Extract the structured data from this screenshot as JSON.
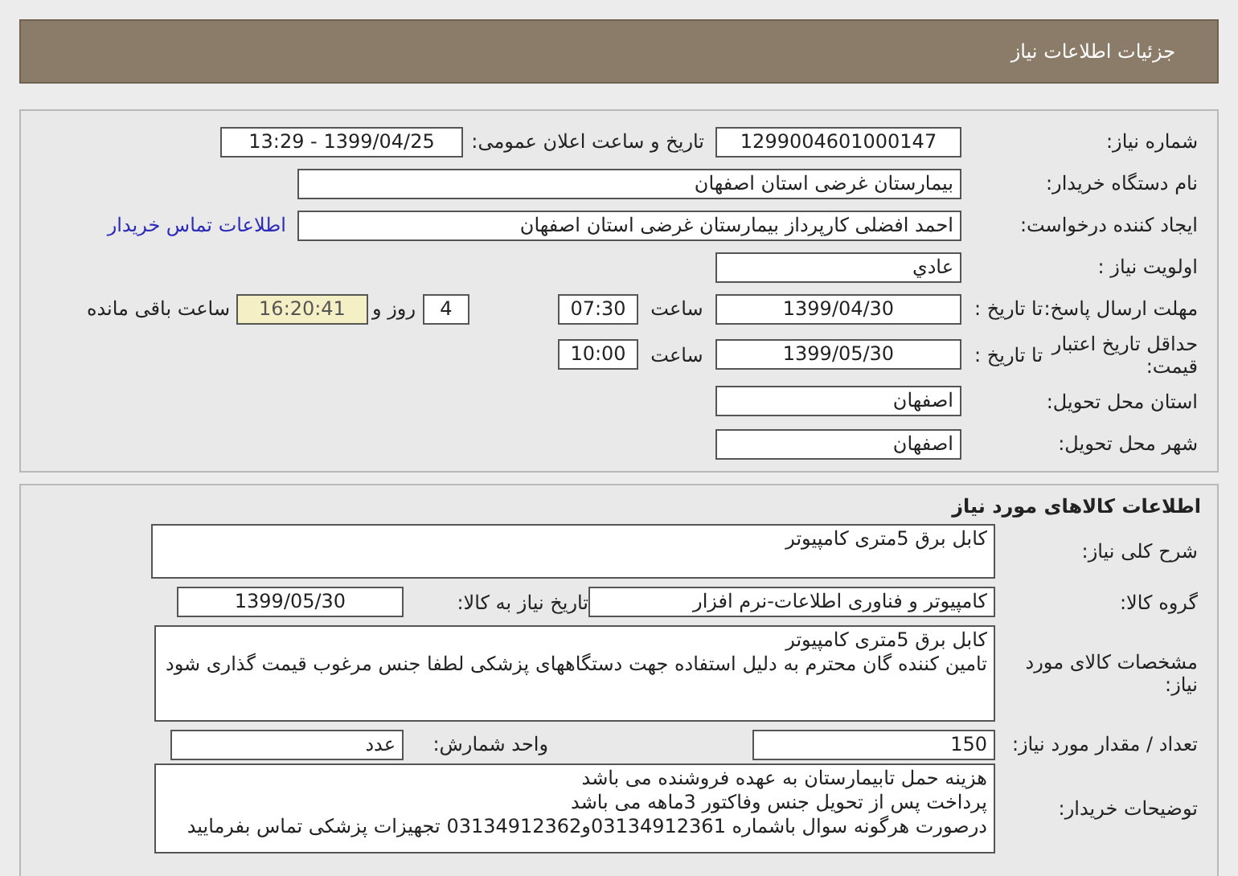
{
  "header": {
    "title": "جزئیات اطلاعات نیاز"
  },
  "details": {
    "rows": [
      {
        "label": "شماره نیاز:",
        "parts": [
          {
            "kind": "field",
            "value": "1299004601000147"
          },
          {
            "kind": "text",
            "text": "تاریخ و ساعت اعلان عمومی:"
          },
          {
            "kind": "field",
            "value": "1399/04/25 - 13:29"
          }
        ]
      },
      {
        "label": "نام دستگاه خریدار:",
        "parts": [
          {
            "kind": "field",
            "value": "بیمارستان غرضی استان اصفهان"
          }
        ]
      },
      {
        "label": "ایجاد کننده درخواست:",
        "parts": [
          {
            "kind": "field",
            "value": "احمد افضلی کارپرداز بیمارستان غرضی استان اصفهان"
          },
          {
            "kind": "link",
            "text": "اطلاعات تماس خریدار"
          }
        ]
      },
      {
        "label": "اولویت نیاز :",
        "parts": [
          {
            "kind": "field",
            "value": "عادي"
          }
        ]
      },
      {
        "label": "مهلت ارسال پاسخ:",
        "sublabel": "تا تاریخ :",
        "parts": [
          {
            "kind": "field",
            "value": "1399/04/30"
          },
          {
            "kind": "text",
            "text": "ساعت"
          },
          {
            "kind": "field",
            "value": "07:30"
          },
          {
            "kind": "field",
            "value": "4"
          },
          {
            "kind": "text",
            "text": "روز و"
          },
          {
            "kind": "timer",
            "value": "16:20:41"
          },
          {
            "kind": "text",
            "text": "ساعت باقی مانده"
          }
        ]
      },
      {
        "label": "حداقل تاریخ اعتبار قیمت:",
        "sublabel": "تا تاریخ :",
        "parts": [
          {
            "kind": "field",
            "value": "1399/05/30"
          },
          {
            "kind": "text",
            "text": "ساعت"
          },
          {
            "kind": "field",
            "value": "10:00"
          }
        ]
      },
      {
        "label": "استان محل تحویل:",
        "parts": [
          {
            "kind": "field",
            "value": "اصفهان"
          }
        ]
      },
      {
        "label": "شهر محل تحویل:",
        "parts": [
          {
            "kind": "field",
            "value": "اصفهان"
          }
        ]
      }
    ]
  },
  "goods": {
    "title": "اطلاعات کالاهای مورد نیاز",
    "rows": [
      {
        "label": "شرح کلی نیاز:",
        "parts": [
          {
            "kind": "textarea",
            "lines": [
              "کابل برق 5متری کامپیوتر"
            ]
          }
        ]
      },
      {
        "label": "گروه کالا:",
        "parts": [
          {
            "kind": "field",
            "value": "کامپیوتر و فناوری اطلاعات-نرم افزار"
          },
          {
            "kind": "text",
            "text": "تاریخ نیاز به کالا:"
          },
          {
            "kind": "field",
            "value": "1399/05/30"
          }
        ]
      },
      {
        "label": "مشخصات کالای مورد نیاز:",
        "parts": [
          {
            "kind": "textarea",
            "lines": [
              "کابل برق 5متری کامپیوتر",
              "تامین کننده گان محترم به دلیل استفاده جهت دستگاههای پزشکی لطفا جنس مرغوب قیمت گذاری شود"
            ]
          }
        ]
      },
      {
        "label": "تعداد / مقدار مورد نیاز:",
        "parts": [
          {
            "kind": "field",
            "value": "150"
          },
          {
            "kind": "text",
            "text": "واحد شمارش:"
          },
          {
            "kind": "field",
            "value": "عدد"
          }
        ]
      },
      {
        "label": "توضیحات خریدار:",
        "parts": [
          {
            "kind": "textarea",
            "lines": [
              "هزینه حمل تابیمارستان به عهده فروشنده می باشد",
              "پرداخت پس از تحویل جنس وفاکتور 3ماهه می باشد",
              "درصورت هرگونه سوال باشماره 03134912361و03134912362 تجهیزات پزشکی تماس بفرمایید"
            ]
          }
        ]
      }
    ]
  }
}
